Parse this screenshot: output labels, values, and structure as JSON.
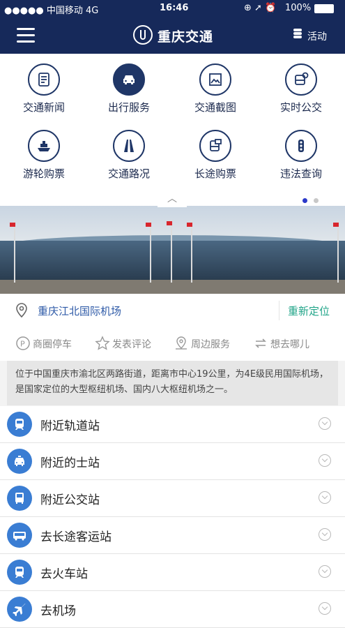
{
  "status_bar": {
    "carrier": "●●●●● 中国移动   4G",
    "time": "16:46",
    "icons": "⊕ ➚ ⏰",
    "battery": "100%"
  },
  "navbar": {
    "title": "重庆交通",
    "activity_label": "活动"
  },
  "grid": {
    "items": [
      {
        "label": "交通新闻",
        "icon": "news-icon"
      },
      {
        "label": "出行服务",
        "icon": "car-icon",
        "active": true
      },
      {
        "label": "交通截图",
        "icon": "image-icon"
      },
      {
        "label": "实时公交",
        "icon": "bus-clock-icon"
      },
      {
        "label": "游轮购票",
        "icon": "ship-icon"
      },
      {
        "label": "交通路况",
        "icon": "road-icon"
      },
      {
        "label": "长途购票",
        "icon": "coach-ticket-icon"
      },
      {
        "label": "违法查询",
        "icon": "traffic-light-icon"
      }
    ],
    "page_indicator": {
      "current": 1,
      "total": 2
    },
    "accent_color": "#1f3667"
  },
  "location": {
    "name": "重庆江北国际机场",
    "relocate_label": "重新定位"
  },
  "actions": [
    {
      "label": "商圈停车",
      "icon": "parking-icon"
    },
    {
      "label": "发表评论",
      "icon": "star-icon"
    },
    {
      "label": "周边服务",
      "icon": "location-icon"
    },
    {
      "label": "想去哪儿",
      "icon": "swap-icon"
    }
  ],
  "description": "位于中国重庆市渝北区两路街道，距离市中心19公里，为4E级民用国际机场，是国家定位的大型枢纽机场、国内八大枢纽机场之一。",
  "list": [
    {
      "label": "附近轨道站",
      "icon": "train-icon"
    },
    {
      "label": "附近的士站",
      "icon": "taxi-icon"
    },
    {
      "label": "附近公交站",
      "icon": "bus-icon"
    },
    {
      "label": "去长途客运站",
      "icon": "coach-icon"
    },
    {
      "label": "去火车站",
      "icon": "train-icon"
    },
    {
      "label": "去机场",
      "icon": "plane-icon"
    }
  ]
}
